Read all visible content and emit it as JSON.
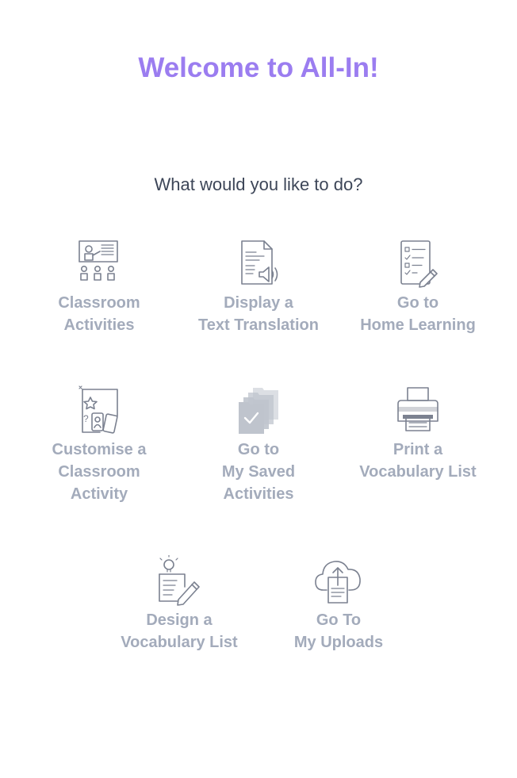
{
  "header": {
    "title": "Welcome to All-In!",
    "prompt": "What would you like to do?"
  },
  "options": [
    {
      "icon": "classroom-icon",
      "line1": "Classroom",
      "line2": "Activities",
      "line3": ""
    },
    {
      "icon": "text-translation-icon",
      "line1": "Display a",
      "line2": "Text Translation",
      "line3": ""
    },
    {
      "icon": "home-learning-icon",
      "line1": "Go to",
      "line2": "Home Learning",
      "line3": ""
    },
    {
      "icon": "customise-activity-icon",
      "line1": "Customise a",
      "line2": "Classroom",
      "line3": "Activity"
    },
    {
      "icon": "saved-activities-icon",
      "line1": "Go to",
      "line2": "My Saved",
      "line3": "Activities"
    },
    {
      "icon": "printer-icon",
      "line1": "Print a",
      "line2": "Vocabulary List",
      "line3": ""
    },
    {
      "icon": "design-list-icon",
      "line1": "Design a",
      "line2": "Vocabulary List",
      "line3": ""
    },
    {
      "icon": "cloud-upload-icon",
      "line1": "Go To",
      "line2": "My Uploads",
      "line3": ""
    }
  ],
  "colors": {
    "title": "#9b7df0",
    "prompt": "#3d4658",
    "label": "#a3abbb",
    "icon_stroke": "#7b8190"
  }
}
